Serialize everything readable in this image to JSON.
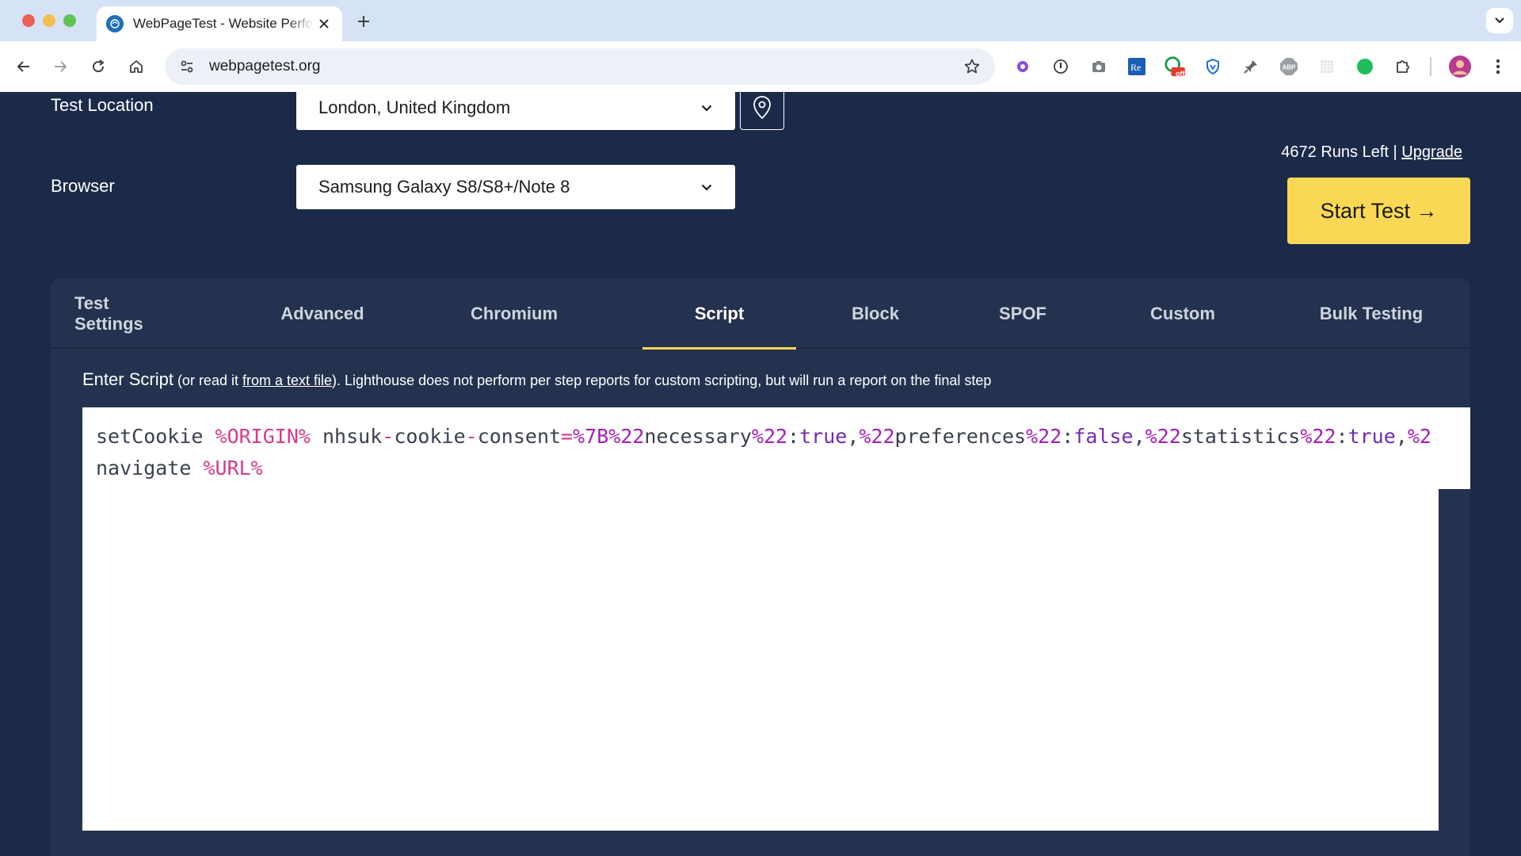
{
  "browser": {
    "tab_title": "WebPageTest - Website Performance and Optimization Test",
    "url": "webpagetest.org",
    "icons": [
      "back-icon",
      "forward-icon",
      "reload-icon",
      "home-icon",
      "site-settings-icon",
      "bookmark-star-icon",
      "new-tab-icon",
      "tab-search-icon"
    ],
    "extension_badge": "off"
  },
  "form": {
    "test_location_label": "Test Location",
    "test_location_value": "London, United Kingdom",
    "browser_label": "Browser",
    "browser_value": "Samsung Galaxy S8/S8+/Note 8"
  },
  "account": {
    "runs_left": "4672 Runs Left",
    "separator": "|",
    "upgrade": "Upgrade"
  },
  "start_button": "Start Test →",
  "tabs": [
    {
      "label": "Test Settings",
      "active": false
    },
    {
      "label": "Advanced",
      "active": false
    },
    {
      "label": "Chromium",
      "active": false
    },
    {
      "label": "Script",
      "active": true
    },
    {
      "label": "Block",
      "active": false
    },
    {
      "label": "SPOF",
      "active": false
    },
    {
      "label": "Custom",
      "active": false
    },
    {
      "label": "Bulk Testing",
      "active": false
    }
  ],
  "script": {
    "lead": "Enter Script",
    "note_open": " (or read it ",
    "note_link": "from a text file",
    "note_close": "). Lighthouse does not perform per step reports for custom scripting, but will run a report on the final step",
    "lines": [
      [
        {
          "t": "setCookie ",
          "c": ""
        },
        {
          "t": "%ORIGIN%",
          "c": "tok-var"
        },
        {
          "t": " nhsuk",
          "c": ""
        },
        {
          "t": "-",
          "c": "tok-op"
        },
        {
          "t": "cookie",
          "c": ""
        },
        {
          "t": "-",
          "c": "tok-op"
        },
        {
          "t": "consent",
          "c": ""
        },
        {
          "t": "=",
          "c": "tok-op"
        },
        {
          "t": "%7B%22",
          "c": "tok-enc"
        },
        {
          "t": "necessary",
          "c": ""
        },
        {
          "t": "%22",
          "c": "tok-enc"
        },
        {
          "t": ":",
          "c": ""
        },
        {
          "t": "true",
          "c": "tok-kw"
        },
        {
          "t": ",",
          "c": ""
        },
        {
          "t": "%22",
          "c": "tok-enc"
        },
        {
          "t": "preferences",
          "c": ""
        },
        {
          "t": "%22",
          "c": "tok-enc"
        },
        {
          "t": ":",
          "c": ""
        },
        {
          "t": "false",
          "c": "tok-kw"
        },
        {
          "t": ",",
          "c": ""
        },
        {
          "t": "%22",
          "c": "tok-enc"
        },
        {
          "t": "statistics",
          "c": ""
        },
        {
          "t": "%22",
          "c": "tok-enc"
        },
        {
          "t": ":",
          "c": ""
        },
        {
          "t": "true",
          "c": "tok-kw"
        },
        {
          "t": ",",
          "c": ""
        },
        {
          "t": "%2",
          "c": "tok-enc"
        }
      ],
      [
        {
          "t": "navigate ",
          "c": ""
        },
        {
          "t": "%URL%",
          "c": "tok-var"
        }
      ]
    ]
  },
  "colors": {
    "page_bg": "#1c2a4a",
    "panel_bg": "#24324f",
    "accent_yellow": "#fad856"
  }
}
